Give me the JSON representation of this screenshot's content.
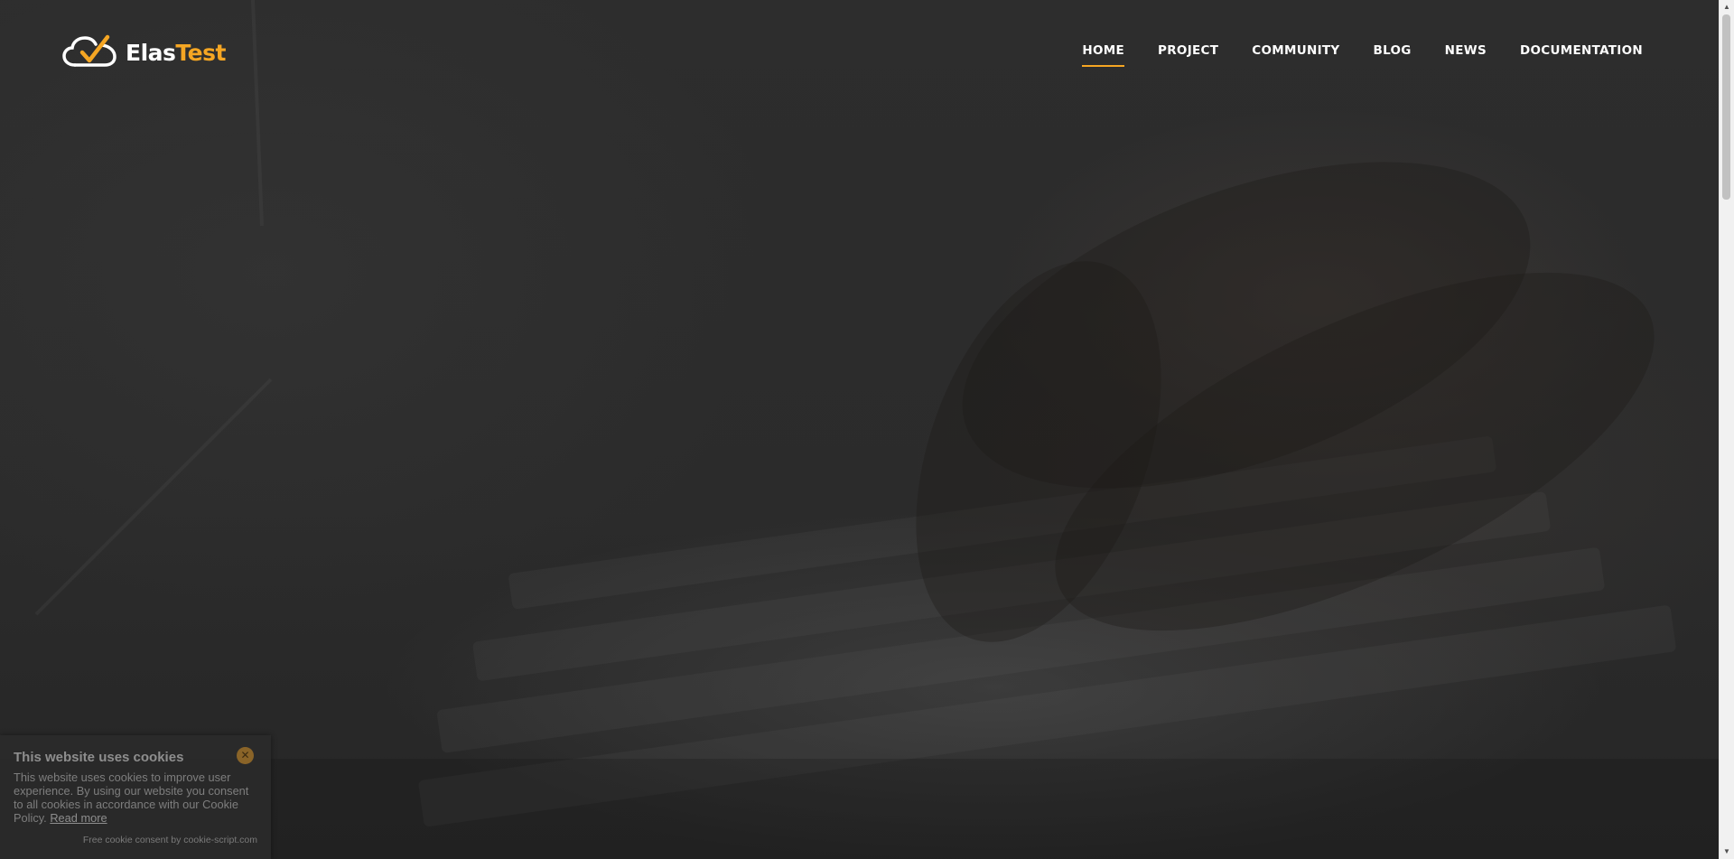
{
  "header": {
    "logo": {
      "text_white": "Elas",
      "text_orange": "Test",
      "icon": "cloud-check-icon"
    },
    "nav": [
      {
        "label": "HOME",
        "active": true
      },
      {
        "label": "PROJECT",
        "active": false
      },
      {
        "label": "COMMUNITY",
        "active": false
      },
      {
        "label": "BLOG",
        "active": false
      },
      {
        "label": "NEWS",
        "active": false
      },
      {
        "label": "DOCUMENTATION",
        "active": false
      }
    ]
  },
  "cookie_banner": {
    "title": "This website uses cookies",
    "body": "This website uses cookies to improve user experience. By using our website you consent to all cookies in accordance with our Cookie Policy.",
    "read_more": "Read more",
    "footer": "Free cookie consent by cookie-script.com",
    "close_icon": "close-icon"
  },
  "colors": {
    "accent": "#f5a623",
    "nav_text": "#ffffff",
    "background": "#2a2a2a"
  }
}
